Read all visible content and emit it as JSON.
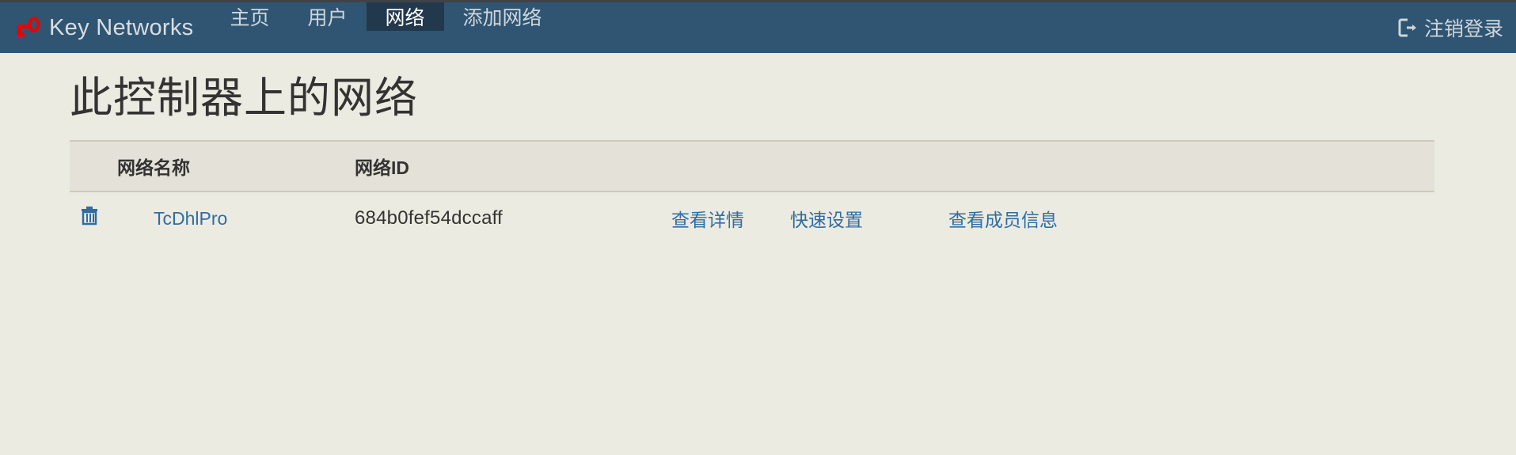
{
  "colors": {
    "navbar_bg": "#2f5573",
    "nav_active_bg": "#22384d",
    "page_bg": "#ecebe1",
    "table_head_bg": "#e4e2d8",
    "link": "#2f6da3",
    "brand_icon": "#ee0000",
    "text": "#333333"
  },
  "navbar": {
    "brand_icon_name": "key-icon",
    "brand_label": "Key Networks",
    "items": [
      {
        "label": "主页",
        "active": false
      },
      {
        "label": "用户",
        "active": false
      },
      {
        "label": "网络",
        "active": true
      },
      {
        "label": "添加网络",
        "active": false
      }
    ],
    "logout": {
      "icon_name": "sign-out-icon",
      "label": "注销登录"
    }
  },
  "main": {
    "page_title": "此控制器上的网络",
    "table": {
      "headers": {
        "delete": "",
        "name": "网络名称",
        "id": "网络ID",
        "action1": "",
        "action2": "",
        "action3": ""
      },
      "rows": [
        {
          "delete_icon": "trash-icon",
          "name": "TcDhlPro",
          "id": "684b0fef54dccaff",
          "action1": "查看详情",
          "action2": "快速设置",
          "action3": "查看成员信息"
        }
      ]
    }
  }
}
